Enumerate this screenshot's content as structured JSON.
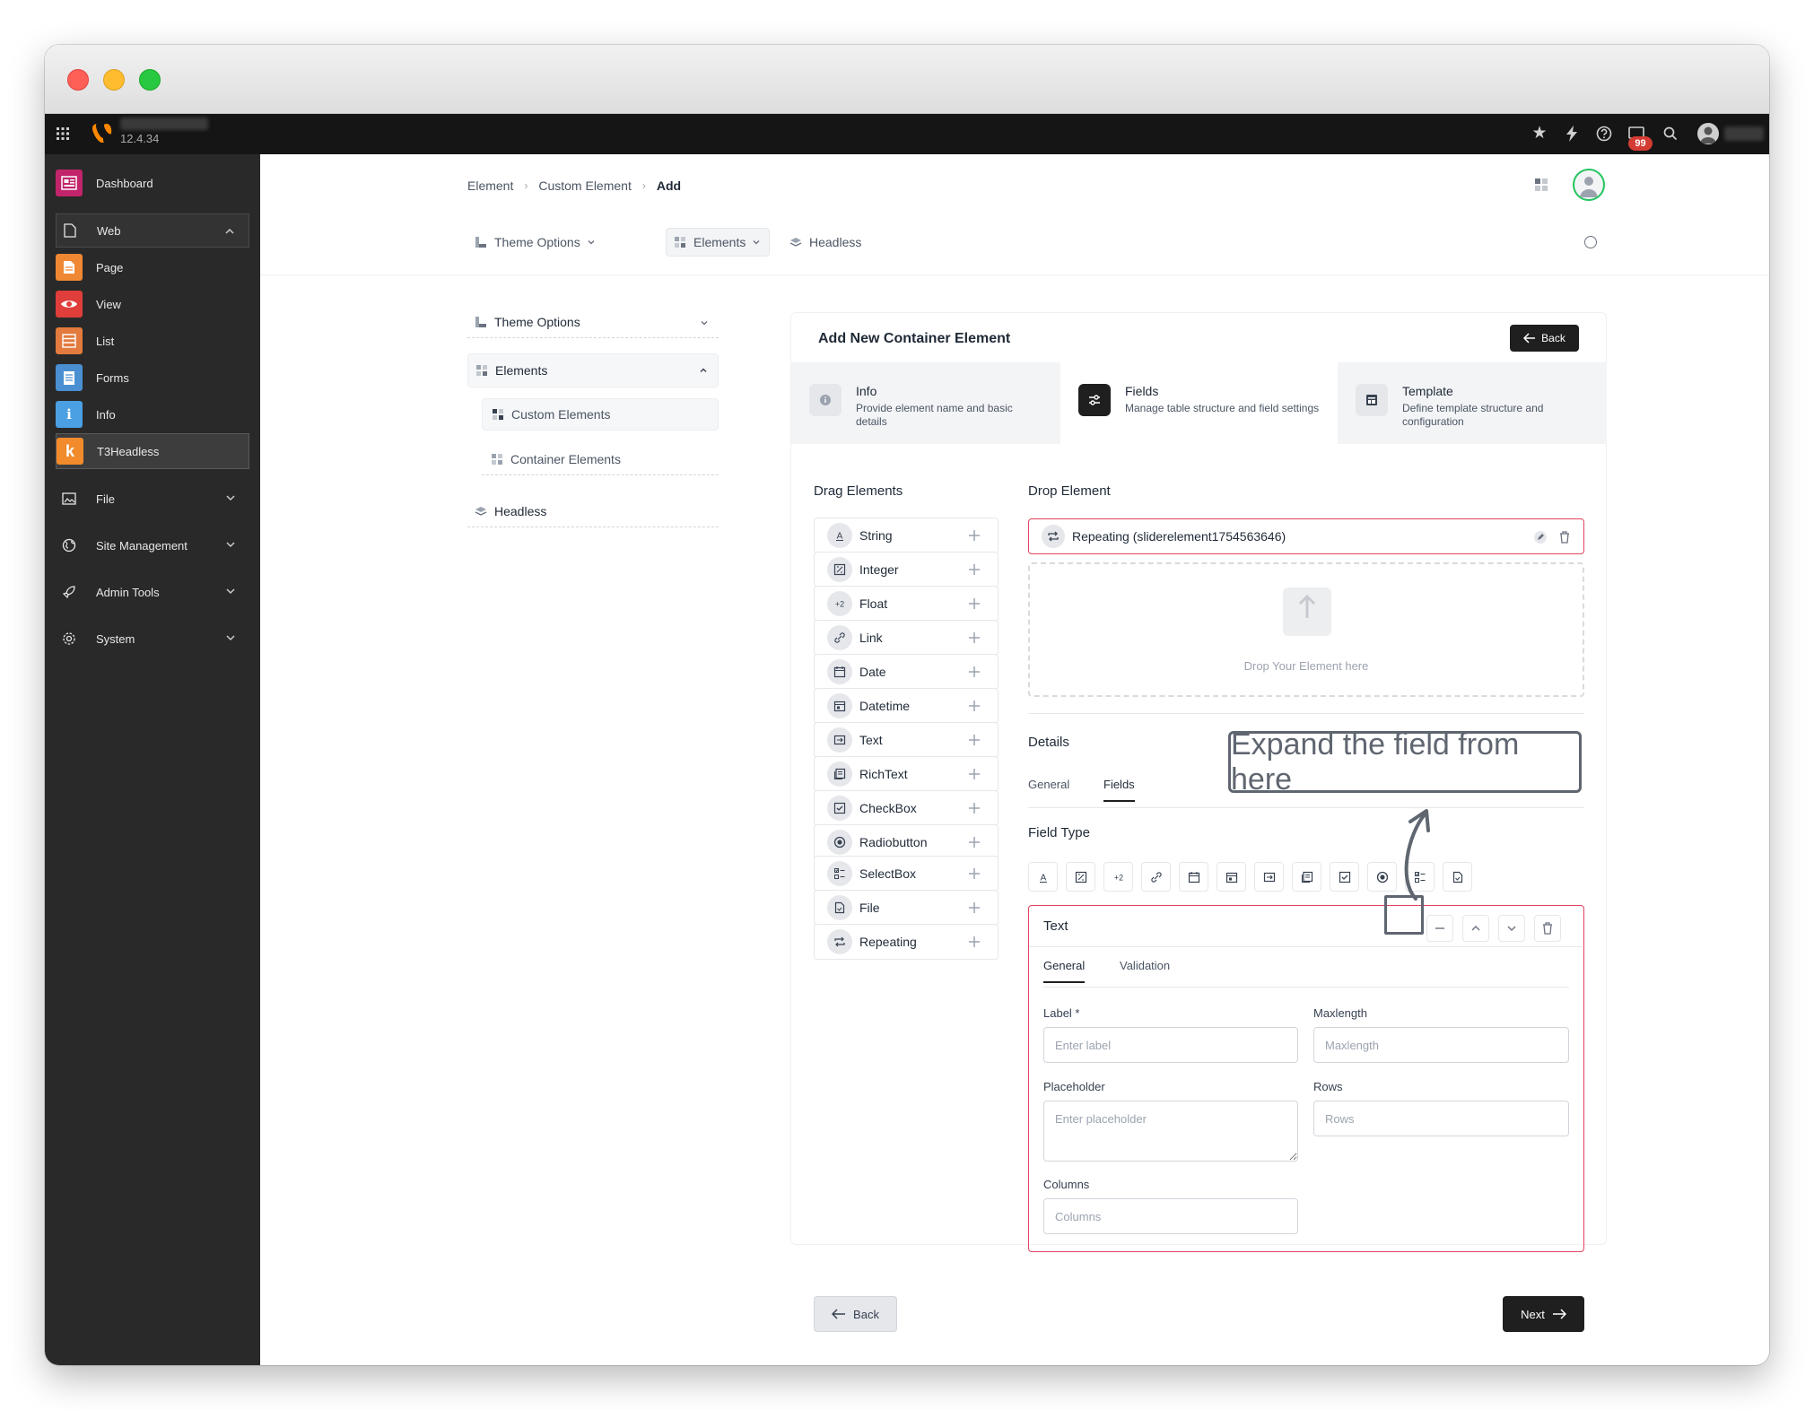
{
  "topbar": {
    "version": "12.4.34",
    "notification_count": "99"
  },
  "sidebar": {
    "dashboard": "Dashboard",
    "web": "Web",
    "web_items": [
      "Page",
      "View",
      "List",
      "Forms",
      "Info",
      "T3Headless"
    ],
    "file": "File",
    "site_management": "Site Management",
    "admin_tools": "Admin Tools",
    "system": "System",
    "colors": {
      "dashboard": "#c1246b",
      "page": "#f08833",
      "view": "#e03e3a",
      "list": "#e27b3d",
      "forms": "#4a8fd1",
      "info": "#4ba0e4",
      "t3headless": "#f18b2b"
    }
  },
  "breadcrumb": [
    "Element",
    "Custom Element",
    "Add"
  ],
  "subnav": {
    "theme_options": "Theme Options",
    "elements": "Elements",
    "headless": "Headless"
  },
  "leftnav": {
    "theme_options": "Theme Options",
    "elements": "Elements",
    "custom_elements": "Custom Elements",
    "container_elements": "Container Elements",
    "headless": "Headless"
  },
  "panel": {
    "title": "Add New Container Element",
    "back": "Back",
    "steps": [
      {
        "title": "Info",
        "desc": "Provide element name and basic details"
      },
      {
        "title": "Fields",
        "desc": "Manage table structure and field settings"
      },
      {
        "title": "Template",
        "desc": "Define template structure and configuration"
      }
    ],
    "drag_title": "Drag Elements",
    "drop_title": "Drop Element",
    "drag_items": [
      "String",
      "Integer",
      "Float",
      "Link",
      "Date",
      "Datetime",
      "Text",
      "RichText",
      "CheckBox",
      "Radiobutton",
      "SelectBox",
      "File",
      "Repeating"
    ],
    "dropped_item": "Repeating (sliderelement1754563646)",
    "drop_placeholder": "Drop Your Element here",
    "details_title": "Details",
    "details_tabs": [
      "General",
      "Fields"
    ],
    "field_type_title": "Field Type",
    "field_card": {
      "title": "Text",
      "tabs": [
        "General",
        "Validation"
      ],
      "label": "Label *",
      "label_placeholder": "Enter label",
      "maxlength": "Maxlength",
      "maxlength_placeholder": "Maxlength",
      "placeholder": "Placeholder",
      "placeholder_placeholder": "Enter placeholder",
      "rows": "Rows",
      "rows_placeholder": "Rows",
      "columns": "Columns",
      "columns_placeholder": "Columns"
    },
    "footer_back": "Back",
    "footer_next": "Next"
  },
  "annotation": "Expand the field from here",
  "colors": {
    "accent_red": "#e3435e",
    "dark": "#1f1f1f",
    "callout": "#5f6670"
  }
}
